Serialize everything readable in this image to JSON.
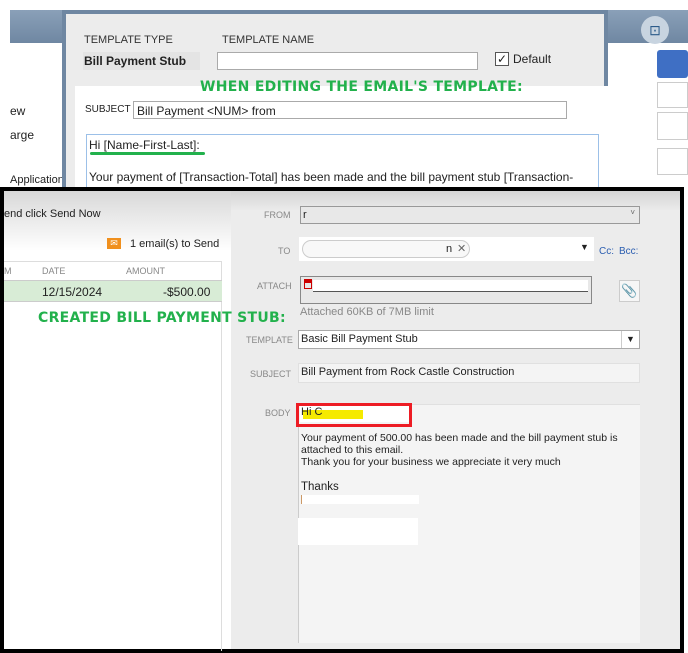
{
  "background_left": {
    "items": [
      "ew",
      "arge",
      "Application"
    ]
  },
  "template_editor": {
    "template_type_label": "TEMPLATE TYPE",
    "template_name_label": "TEMPLATE NAME",
    "template_type_value": "Bill Payment Stub",
    "template_name_value": "",
    "default_label": "Default",
    "default_checked": true,
    "annotation": "WHEN EDITING THE EMAIL'S TEMPLATE:",
    "subject_label": "SUBJECT",
    "subject_value": "Bill Payment <NUM> from",
    "body_line1": "Hi [Name-First-Last]:",
    "body_line2": "Your payment of [Transaction-Total]  has been made and the bill payment stub [Transaction-"
  },
  "send_panel": {
    "instruction": "end click Send Now",
    "email_count": "1 email(s) to Send",
    "columns": [
      "M",
      "DATE",
      "AMOUNT"
    ],
    "rows": [
      {
        "date": "12/15/2024",
        "amount": "-$500.00"
      }
    ],
    "annotation": "CREATED BILL PAYMENT STUB:"
  },
  "email": {
    "from_label": "FROM",
    "from_value": "r",
    "to_label": "TO",
    "to_value": "n",
    "cc": "Cc:",
    "bcc": "Bcc:",
    "attach_label": "ATTACH",
    "attach_note": "Attached 60KB of 7MB limit",
    "template_label": "TEMPLATE",
    "template_value": "Basic Bill Payment Stub",
    "subject_label": "SUBJECT",
    "subject_value": "Bill Payment  from Rock Castle Construction",
    "body_label": "BODY",
    "body_greeting": "Hi C",
    "body_line1": "Your payment of 500.00  has been made and the bill payment stub  is",
    "body_line2": "attached to this email.",
    "body_line3": "Thank you for your business  we appreciate it very much",
    "body_thanks": "Thanks"
  },
  "colors": {
    "annotation_green": "#22b14c",
    "highlight_red": "#ed1c24",
    "row_green": "#d8ecd6"
  }
}
